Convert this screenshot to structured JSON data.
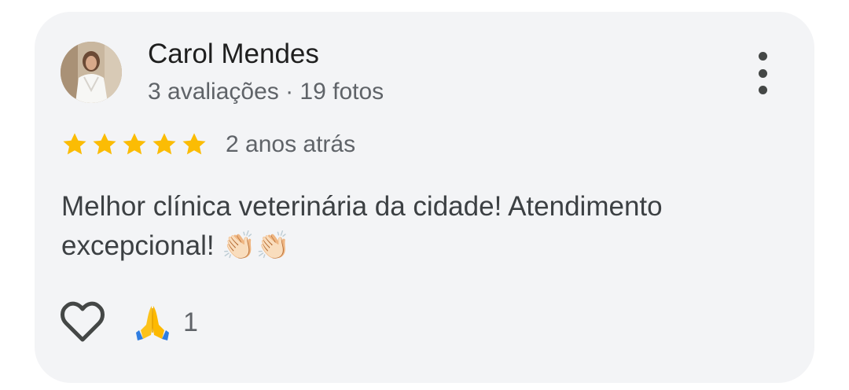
{
  "review": {
    "reviewer_name": "Carol Mendes",
    "reviewer_meta": "3 avaliações · 19 fotos",
    "rating": 5,
    "rating_max": 5,
    "time_ago": "2 anos atrás",
    "text": "Melhor clínica veterinária da cidade! Atendimento excepcional!",
    "text_emojis": "👏🏻👏🏻",
    "reaction_emoji": "🙏",
    "reaction_count": "1"
  },
  "icons": {
    "more": "more-vert-icon",
    "star": "star-icon",
    "like": "heart-outline-icon",
    "reaction": "folded-hands-icon"
  },
  "colors": {
    "card_background": "#f3f4f6",
    "star": "#fbbc04",
    "primary_text": "#1f1f1f",
    "secondary_text": "#5f6368"
  }
}
